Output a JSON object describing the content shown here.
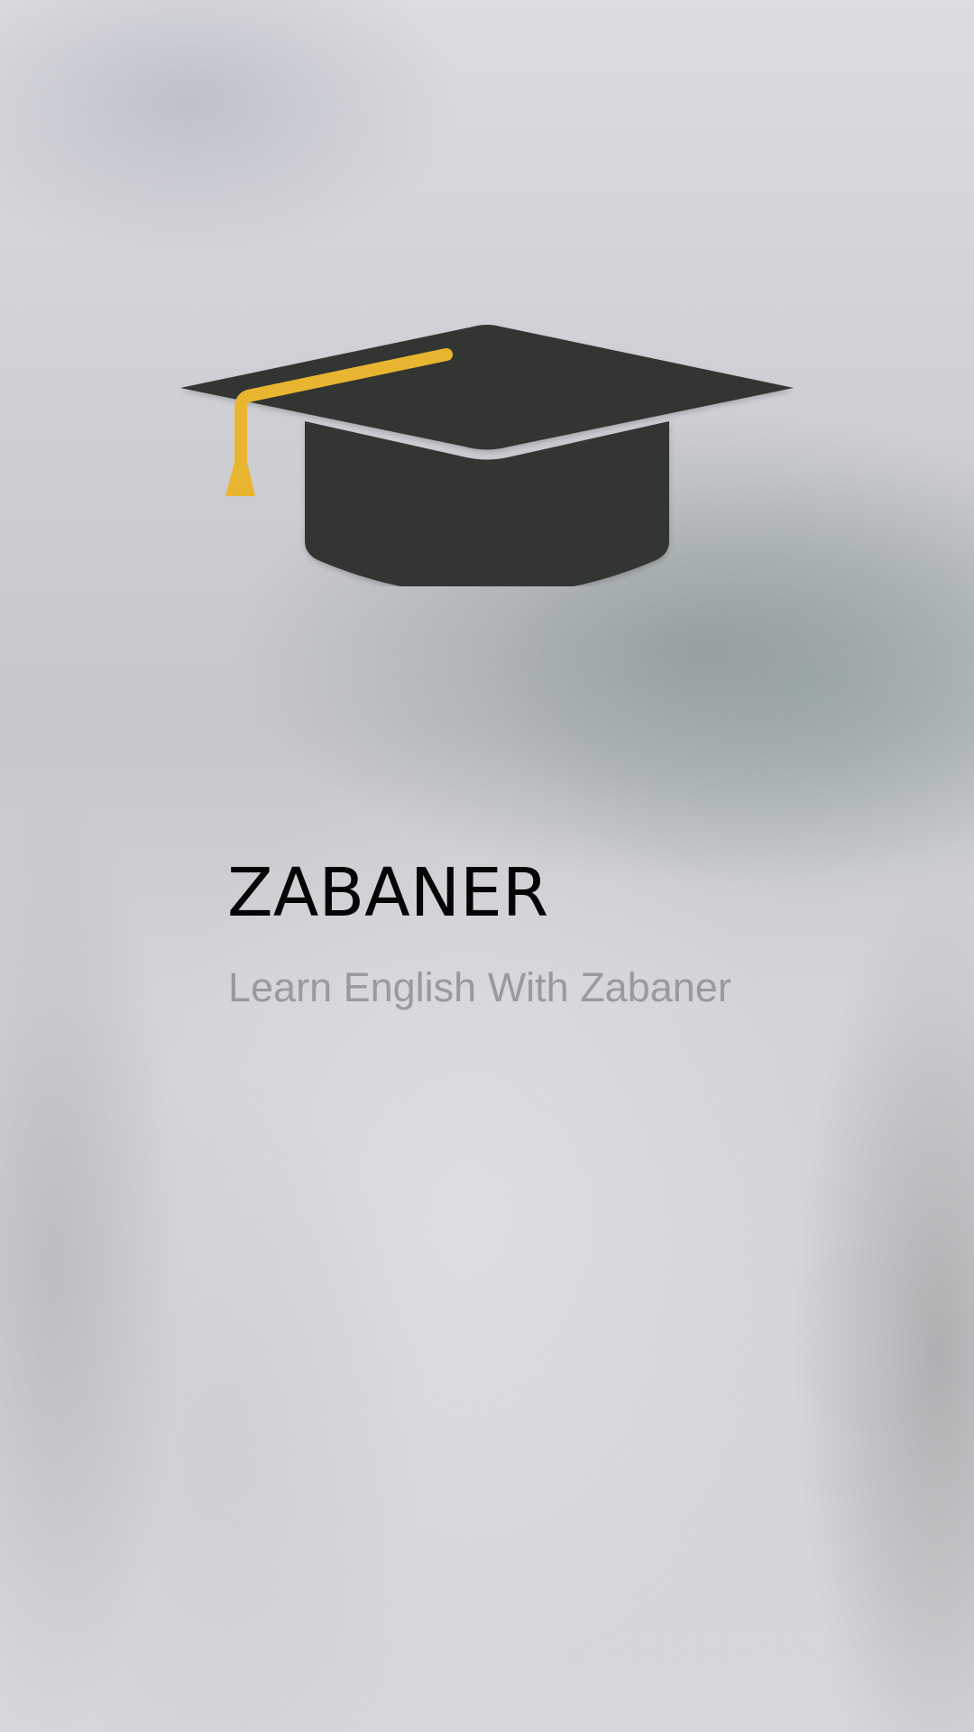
{
  "app": {
    "title": "ZABANER",
    "subtitle": "Learn English With Zabaner"
  },
  "logo": {
    "icon": "graduation-cap-icon",
    "cap_color": "#333433",
    "tassel_color": "#E9B530"
  }
}
